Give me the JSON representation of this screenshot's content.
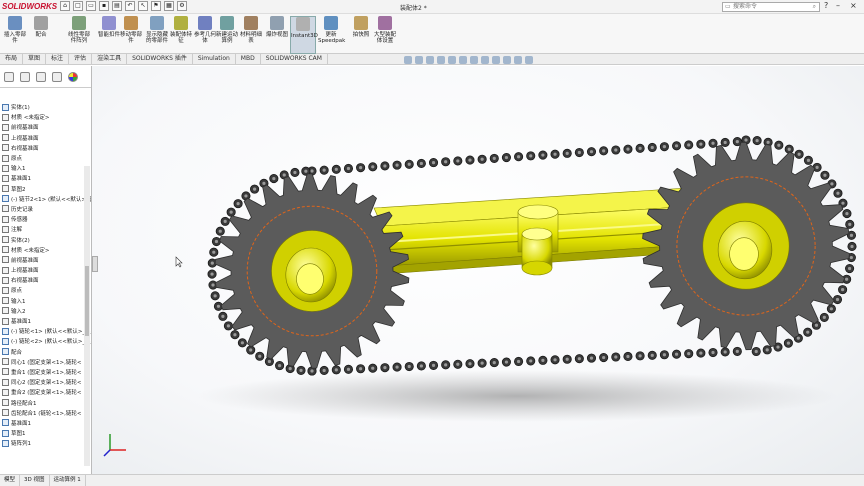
{
  "app": {
    "logo": "SOLIDWORKS",
    "doc_title": "装配体2 *"
  },
  "search": {
    "placeholder": "搜索命令"
  },
  "ribbon": [
    {
      "label": "插入零部件"
    },
    {
      "label": "配合"
    },
    {
      "label": "线性零部件阵列"
    },
    {
      "label": "智能扣件"
    },
    {
      "label": "移动零部件"
    },
    {
      "label": "显示隐藏的零部件"
    },
    {
      "label": "装配体特征"
    },
    {
      "label": "参考几何体"
    },
    {
      "label": "新建运动算例"
    },
    {
      "label": "材料明细表"
    },
    {
      "label": "爆炸视图"
    },
    {
      "label": "Instant3D"
    },
    {
      "label": "更新Speedpak"
    },
    {
      "label": "拍快照"
    },
    {
      "label": "大型装配体设置"
    }
  ],
  "tabs": [
    "布局",
    "草图",
    "标注",
    "评估",
    "渲染工具",
    "SOLIDWORKS 插件",
    "Simulation",
    "MBD",
    "SOLIDWORKS CAM"
  ],
  "tree": [
    {
      "label": "实体(1)",
      "ind": false
    },
    {
      "label": "材质 <未指定>",
      "ind": true
    },
    {
      "label": "前视基准面",
      "ind": true
    },
    {
      "label": "上视基准面",
      "ind": true
    },
    {
      "label": "右视基准面",
      "ind": true
    },
    {
      "label": "原点",
      "ind": true
    },
    {
      "label": "输入1",
      "ind": true
    },
    {
      "label": "基准面1",
      "ind": true
    },
    {
      "label": "草图2",
      "ind": true
    },
    {
      "label": "(-) 链节2<1> (默认<<默认>_显示",
      "ind": false
    },
    {
      "label": "历史记录",
      "ind": true
    },
    {
      "label": "传感器",
      "ind": true
    },
    {
      "label": "注解",
      "ind": true
    },
    {
      "label": "实体(2)",
      "ind": true
    },
    {
      "label": "材质 <未指定>",
      "ind": true
    },
    {
      "label": "前视基准面",
      "ind": true
    },
    {
      "label": "上视基准面",
      "ind": true
    },
    {
      "label": "右视基准面",
      "ind": true
    },
    {
      "label": "原点",
      "ind": true
    },
    {
      "label": "输入1",
      "ind": true
    },
    {
      "label": "输入2",
      "ind": true
    },
    {
      "label": "基准面1",
      "ind": true
    },
    {
      "label": "(-) 链轮<1> (默认<<默认>_显示",
      "ind": false
    },
    {
      "label": "(-) 链轮<2> (默认<<默认>_显示",
      "ind": false
    },
    {
      "label": "配合",
      "ind": false
    },
    {
      "label": "同心1 (固定支架<1>,链轮<",
      "ind": true
    },
    {
      "label": "重合1 (固定支架<1>,链轮<",
      "ind": true
    },
    {
      "label": "同心2 (固定支架<1>,链轮<",
      "ind": true
    },
    {
      "label": "重合2 (固定支架<1>,链轮<",
      "ind": true
    },
    {
      "label": "路径配合1",
      "ind": true
    },
    {
      "label": "齿轮配合1 (链轮<1>,链轮<",
      "ind": true
    },
    {
      "label": "基准面1",
      "ind": false
    },
    {
      "label": "草图1",
      "ind": false
    },
    {
      "label": "链阵列1",
      "ind": false
    }
  ],
  "bottom_tabs": [
    "模型",
    "3D 视图",
    "运动算例 1"
  ],
  "colors": {
    "yellow": "#e6e600",
    "sprocket": "#5b5b5b",
    "chain": "#3a3a3a",
    "accent": "#c8102e"
  }
}
